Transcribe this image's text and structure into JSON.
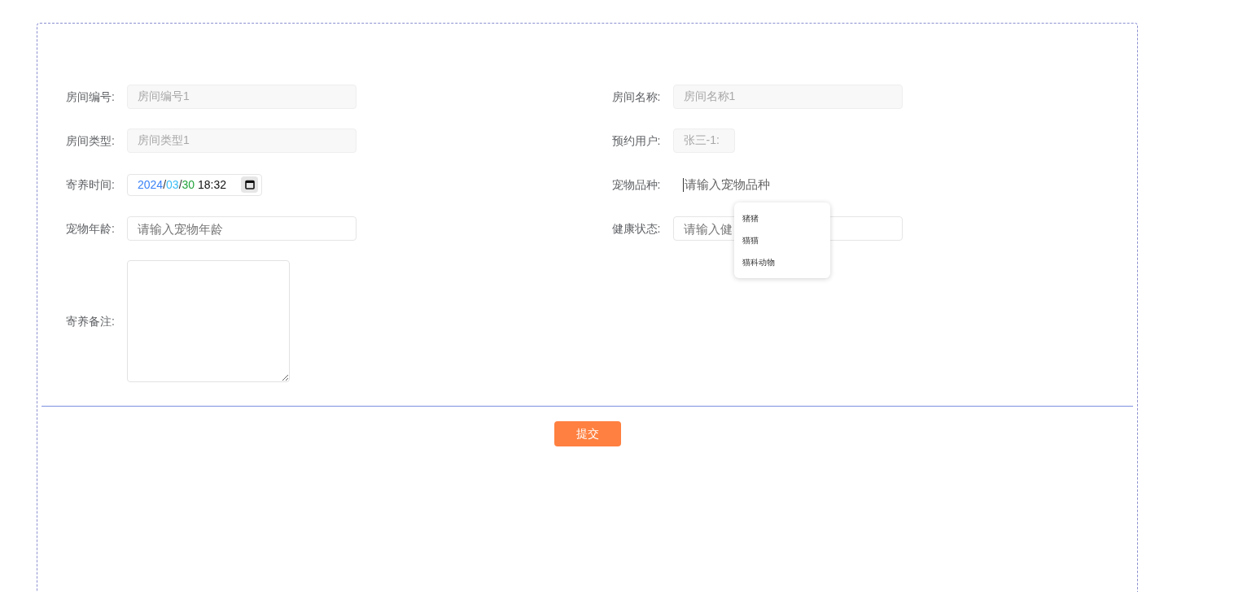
{
  "form": {
    "fields": [
      {
        "label": "房间编号:",
        "kind": "readonly",
        "value": "房间编号1",
        "wide": true
      },
      {
        "label": "房间名称:",
        "kind": "readonly",
        "value": "房间名称1",
        "wide": true
      },
      {
        "label": "房间类型:",
        "kind": "readonly",
        "value": "房间类型1",
        "wide": true
      },
      {
        "label": "预约用户:",
        "kind": "readonly",
        "value": "张三-1:",
        "wide": false
      },
      {
        "label": "寄养时间:",
        "kind": "datetime",
        "parts": [
          {
            "text": "2024",
            "color": "#3b82f6"
          },
          {
            "text": "/",
            "color": "#333333"
          },
          {
            "text": "03",
            "color": "#38bdf8"
          },
          {
            "text": "/",
            "color": "#333333"
          },
          {
            "text": "30",
            "color": "#22a33a"
          },
          {
            "text": " 18:32",
            "color": "#111111"
          }
        ]
      },
      {
        "label": "宠物品种:",
        "kind": "plain",
        "placeholder": "请输入宠物品种",
        "focused": true,
        "suggestions": [
          "猪猪",
          "猫猫",
          "猫科动物"
        ]
      },
      {
        "label": "宠物年龄:",
        "kind": "text",
        "placeholder": "请输入宠物年龄"
      },
      {
        "label": "健康状态:",
        "kind": "text",
        "placeholder": "请输入健"
      },
      {
        "label": "寄养备注:",
        "kind": "textarea"
      }
    ]
  },
  "submit": "提交"
}
